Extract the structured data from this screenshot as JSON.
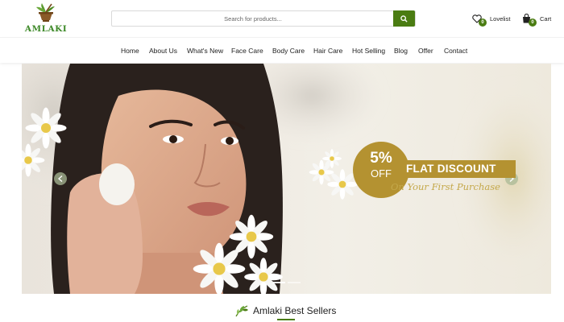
{
  "brand": {
    "name": "AMLAKI",
    "logo_icon": "mortar-herb-logo"
  },
  "search": {
    "placeholder": "Search for products...",
    "button_icon": "search-icon"
  },
  "header_links": {
    "lovelist": {
      "label": "Lovelist",
      "count": "0",
      "icon": "heart-icon"
    },
    "cart": {
      "label": "Cart",
      "count": "0",
      "icon": "shopping-bag-icon"
    }
  },
  "nav": {
    "items": [
      {
        "label": "Home"
      },
      {
        "label": "About Us"
      },
      {
        "label": "What's New"
      },
      {
        "label": "Face Care"
      },
      {
        "label": "Body Care"
      },
      {
        "label": "Hair Care"
      },
      {
        "label": "Hot Selling"
      },
      {
        "label": "Blog"
      },
      {
        "label": "Offer"
      },
      {
        "label": "Contact"
      }
    ]
  },
  "hero": {
    "percent": "5%",
    "off": "OFF",
    "headline": "FLAT DISCOUNT",
    "tagline": "On Your First Purchase",
    "slides_total": 2,
    "active_slide": 1
  },
  "section": {
    "title": "Amlaki Best Sellers",
    "icon": "leaf-sprig-icon"
  },
  "colors": {
    "brand_green": "#4a7c12",
    "promo_gold": "#b49231",
    "logo_green": "#3f8a2a"
  }
}
